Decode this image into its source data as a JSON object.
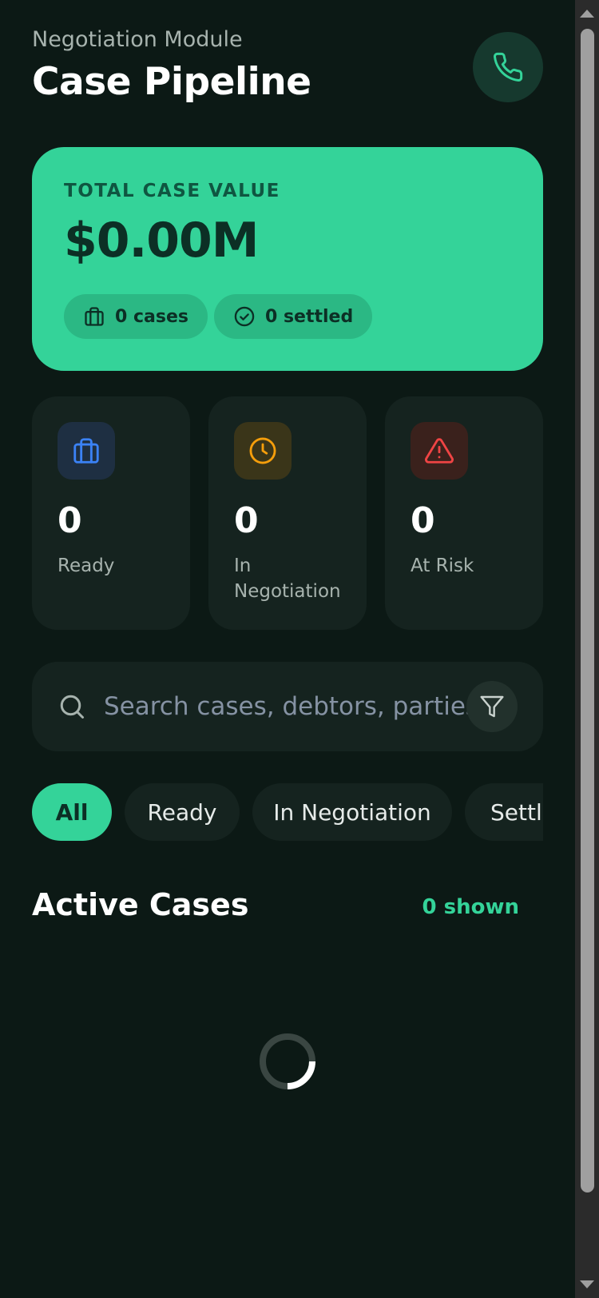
{
  "header": {
    "subtitle": "Negotiation Module",
    "title": "Case Pipeline",
    "call_icon": "phone-icon"
  },
  "summary": {
    "label": "TOTAL CASE VALUE",
    "value": "$0.00M",
    "cases_chip": "0 cases",
    "settled_chip": "0 settled"
  },
  "stats": [
    {
      "icon": "briefcase-icon",
      "value": "0",
      "label": "Ready",
      "color": "#3b82f6",
      "bg": "#1e2f42"
    },
    {
      "icon": "clock-icon",
      "value": "0",
      "label": "In Negotiation",
      "color": "#f59e0b",
      "bg": "#3a3519"
    },
    {
      "icon": "alert-triangle-icon",
      "value": "0",
      "label": "At Risk",
      "color": "#ef4444",
      "bg": "#3a211c"
    }
  ],
  "search": {
    "placeholder": "Search cases, debtors, parties..."
  },
  "tabs": [
    {
      "label": "All",
      "active": true
    },
    {
      "label": "Ready",
      "active": false
    },
    {
      "label": "In Negotiation",
      "active": false
    },
    {
      "label": "Settled",
      "active": false
    }
  ],
  "section": {
    "title": "Active Cases",
    "count": "0 shown"
  },
  "colors": {
    "accent": "#34d399",
    "background": "#0c1915",
    "card": "#15231f"
  }
}
